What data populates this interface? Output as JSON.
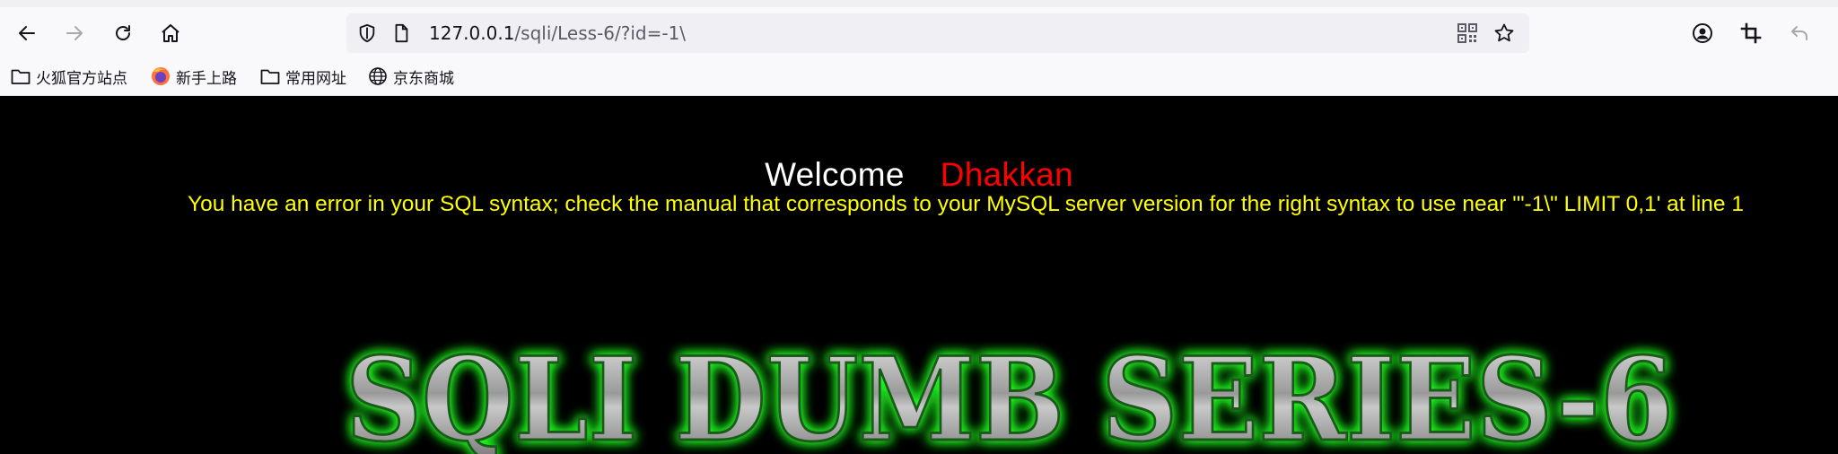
{
  "browser": {
    "url": {
      "host": "127.0.0.1",
      "path": "/sqli/Less-6/?id=-1\\"
    },
    "bookmarks": [
      {
        "label": "火狐官方站点",
        "icon": "folder-icon"
      },
      {
        "label": "新手上路",
        "icon": "firefox-icon"
      },
      {
        "label": "常用网址",
        "icon": "folder-icon"
      },
      {
        "label": "京东商城",
        "icon": "globe-icon"
      }
    ]
  },
  "page": {
    "welcome": "Welcome",
    "name": "Dhakkan",
    "error": "You have an error in your SQL syntax; check the manual that corresponds to your MySQL server version for the right syntax to use near '\"-1\\\" LIMIT 0,1' at line 1",
    "banner": "SQLI DUMB SERIES-6",
    "colors": {
      "background": "#000000",
      "welcome": "#ffffff",
      "name": "#ff0000",
      "error": "#ffff00",
      "banner_glow": "#22ff22"
    }
  }
}
